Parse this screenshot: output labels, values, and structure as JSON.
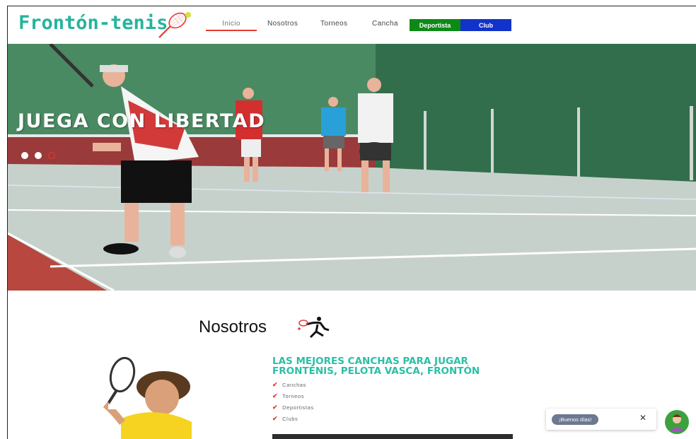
{
  "header": {
    "logo_text": "Frontón-tenis",
    "nav": {
      "inicio": "Inicio",
      "nosotros": "Nosotros",
      "torneos": "Torneos",
      "cancha": "Cancha",
      "deportista": "Deportista",
      "club": "Club"
    }
  },
  "hero": {
    "title": "JUEGA CON LIBERTAD",
    "slides": 3,
    "active_slide": 3
  },
  "nosotros": {
    "title": "Nosotros",
    "feature_title_line1": "LAS MEJORES CANCHAS PARA JUGAR",
    "feature_title_line2": "FRONTENIS, PELOTA VASCA, FRONTÓN",
    "items": [
      "Canchas",
      "Torneos",
      "Deportistas",
      "Clubs"
    ]
  },
  "chat": {
    "greeting": "¡Buenos días!",
    "close_label": "✕"
  },
  "colors": {
    "brand": "#26b49c",
    "accent": "#e53935",
    "deportista": "#0d8a16",
    "club": "#1233c9"
  }
}
